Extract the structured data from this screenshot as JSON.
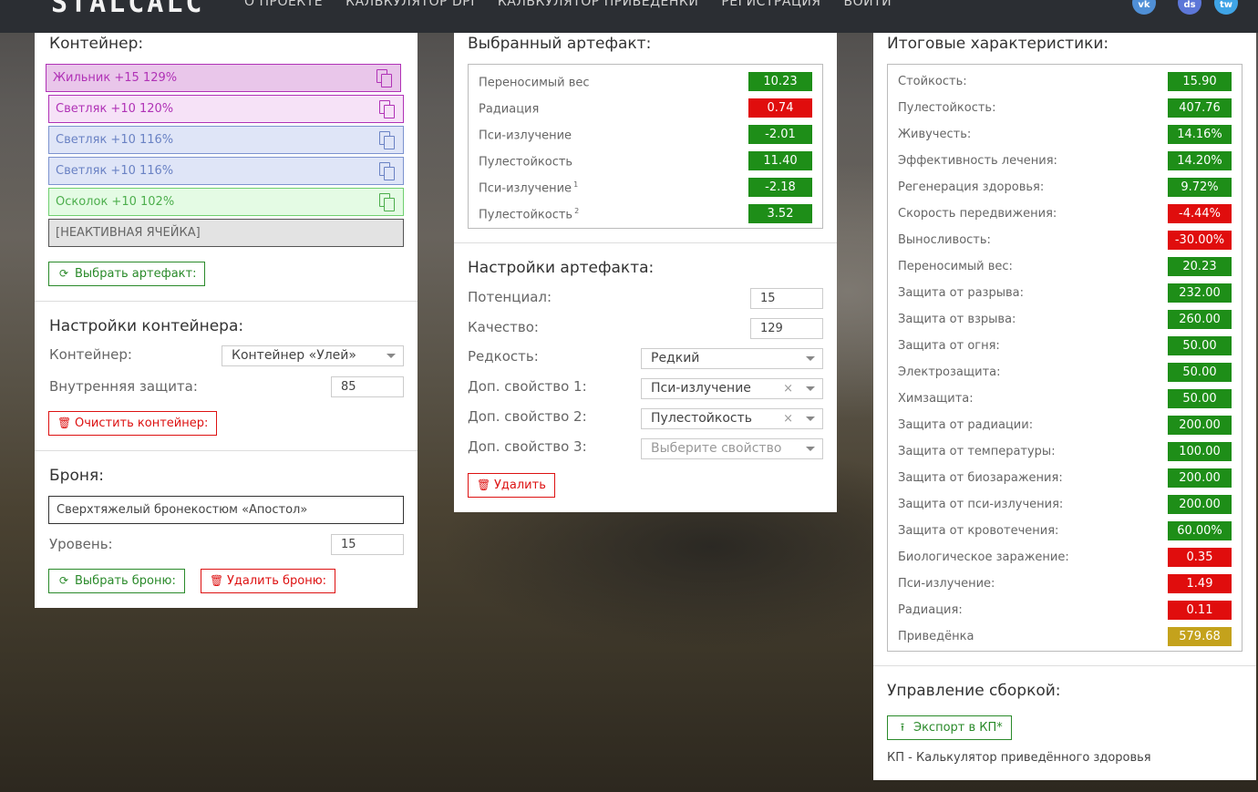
{
  "topbar": {
    "logo": "STALCALC",
    "nav": [
      "О ПРОЕКТЕ",
      "КАЛЬКУЛЯТОР DPI",
      "КАЛЬКУЛЯТОР ПРИВЕДЕНКИ",
      "РЕГИСТРАЦИЯ",
      "ВОЙТИ"
    ],
    "social": [
      {
        "icon": "vk-icon",
        "glyph": "vk"
      },
      {
        "icon": "discord-icon",
        "glyph": "ds"
      },
      {
        "icon": "twitter-icon",
        "glyph": "tw"
      }
    ]
  },
  "container": {
    "title": "Контейнер:",
    "slots": [
      {
        "label": "Жильник +15 129%",
        "state": "selected"
      },
      {
        "label": "Светляк +10 120%",
        "state": "pink"
      },
      {
        "label": "Светляк +10 116%",
        "state": "blue"
      },
      {
        "label": "Светляк +10 116%",
        "state": "blue"
      },
      {
        "label": "Осколок +10 102%",
        "state": "green"
      },
      {
        "label": "[НЕАКТИВНАЯ ЯЧЕЙКА]",
        "state": "inactive"
      }
    ],
    "choose_button": "Выбрать артефакт:"
  },
  "container_settings": {
    "title": "Настройки контейнера:",
    "container_label": "Контейнер:",
    "container_value": "Контейнер «Улей»",
    "inner_protection_label": "Внутренняя защита:",
    "inner_protection_value": "85",
    "clear_button": "Очистить контейнер:"
  },
  "armor": {
    "title": "Броня:",
    "armor_value": "Сверхтяжелый бронекостюм «Апостол»",
    "level_label": "Уровень:",
    "level_value": "15",
    "choose_button": "Выбрать броню:",
    "delete_button": "Удалить броню:"
  },
  "selected_artifact": {
    "title": "Выбранный артефакт:",
    "stats": [
      {
        "name": "Переносимый вес",
        "sup": "",
        "value": "10.23",
        "color": "green"
      },
      {
        "name": "Радиация",
        "sup": "",
        "value": "0.74",
        "color": "red"
      },
      {
        "name": "Пси-излучение",
        "sup": "",
        "value": "-2.01",
        "color": "green"
      },
      {
        "name": "Пулестойкость",
        "sup": "",
        "value": "11.40",
        "color": "green"
      },
      {
        "name": "Пси-излучение",
        "sup": "1",
        "value": "-2.18",
        "color": "green"
      },
      {
        "name": "Пулестойкость",
        "sup": "2",
        "value": "3.52",
        "color": "green"
      }
    ]
  },
  "artifact_settings": {
    "title": "Настройки артефакта:",
    "potential_label": "Потенциал:",
    "potential_value": "15",
    "quality_label": "Качество:",
    "quality_value": "129",
    "rarity_label": "Редкость:",
    "rarity_value": "Редкий",
    "extra1_label": "Доп. свойство 1:",
    "extra1_value": "Пси-излучение",
    "extra2_label": "Доп. свойство 2:",
    "extra2_value": "Пулестойкость",
    "extra3_label": "Доп. свойство 3:",
    "extra3_placeholder": "Выберите свойство",
    "delete_button": "Удалить"
  },
  "totals": {
    "title": "Итоговые характеристики:",
    "stats": [
      {
        "name": "Стойкость:",
        "value": "15.90",
        "color": "green"
      },
      {
        "name": "Пулестойкость:",
        "value": "407.76",
        "color": "green"
      },
      {
        "name": "Живучесть:",
        "value": "14.16%",
        "color": "green"
      },
      {
        "name": "Эффективность лечения:",
        "value": "14.20%",
        "color": "green"
      },
      {
        "name": "Регенерация здоровья:",
        "value": "9.72%",
        "color": "green"
      },
      {
        "name": "Скорость передвижения:",
        "value": "-4.44%",
        "color": "red"
      },
      {
        "name": "Выносливость:",
        "value": "-30.00%",
        "color": "red"
      },
      {
        "name": "Переносимый вес:",
        "value": "20.23",
        "color": "green"
      },
      {
        "name": "Защита от разрыва:",
        "value": "232.00",
        "color": "green"
      },
      {
        "name": "Защита от взрыва:",
        "value": "260.00",
        "color": "green"
      },
      {
        "name": "Защита от огня:",
        "value": "50.00",
        "color": "green"
      },
      {
        "name": "Электрозащита:",
        "value": "50.00",
        "color": "green"
      },
      {
        "name": "Химзащита:",
        "value": "50.00",
        "color": "green"
      },
      {
        "name": "Защита от радиации:",
        "value": "200.00",
        "color": "green"
      },
      {
        "name": "Защита от температуры:",
        "value": "100.00",
        "color": "green"
      },
      {
        "name": "Защита от биозаражения:",
        "value": "200.00",
        "color": "green"
      },
      {
        "name": "Защита от пси-излучения:",
        "value": "200.00",
        "color": "green"
      },
      {
        "name": "Защита от кровотечения:",
        "value": "60.00%",
        "color": "green"
      },
      {
        "name": "Биологическое заражение:",
        "value": "0.35",
        "color": "red"
      },
      {
        "name": "Пси-излучение:",
        "value": "1.49",
        "color": "red"
      },
      {
        "name": "Радиация:",
        "value": "0.11",
        "color": "red"
      },
      {
        "name": "Приведёнка",
        "value": "579.68",
        "color": "gold"
      }
    ]
  },
  "build": {
    "title": "Управление сборкой:",
    "export_button": "Экспорт в КП*",
    "footnote": "КП - Калькулятор приведённого здоровья"
  },
  "colors": {
    "green": "#1e8e18",
    "red": "#e00d0d",
    "gold": "#c4a21c",
    "slot_selected_bg": "#e9c6ea",
    "slot_selected_border": "#b032b6",
    "slot_pink_bg": "#f6e2f7",
    "slot_blue_bg": "#dfe5f7",
    "slot_green_bg": "#e4fbe4",
    "slot_inactive_bg": "#e3e3e3"
  }
}
